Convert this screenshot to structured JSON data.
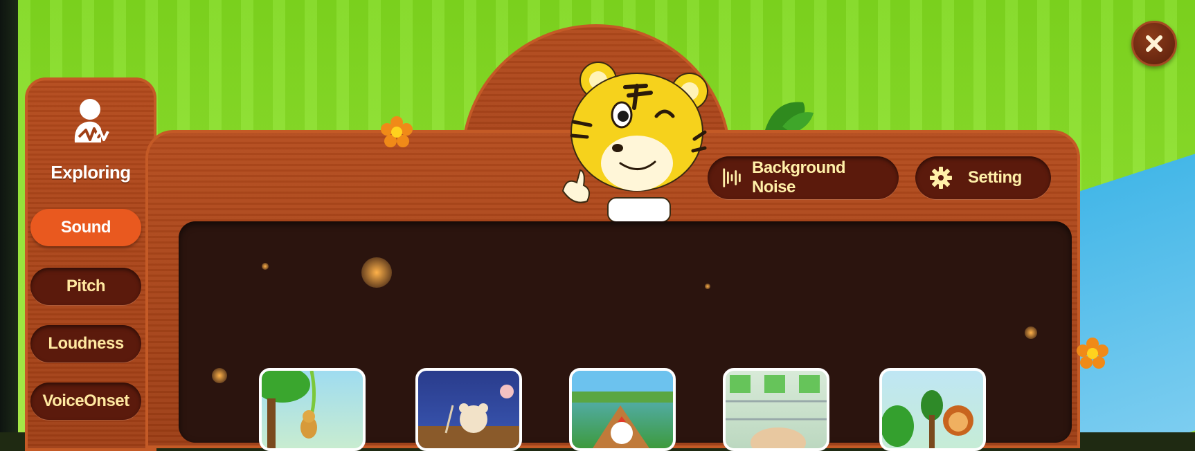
{
  "sidebar": {
    "heading": "Exploring",
    "heading_icon": "person-voice-wave-icon",
    "items": [
      {
        "label": "Sound",
        "active": true
      },
      {
        "label": "Pitch",
        "active": false
      },
      {
        "label": "Loudness",
        "active": false
      },
      {
        "label": "VoiceOnset",
        "active": false
      }
    ]
  },
  "header": {
    "background_noise_label": "Background Noise",
    "background_noise_icon": "sound-wave-icon",
    "setting_label": "Setting",
    "setting_icon": "gear-icon"
  },
  "close_icon": "close-icon",
  "cards": [
    {
      "name": "monkey-vine-card"
    },
    {
      "name": "bear-night-card"
    },
    {
      "name": "rooster-barn-card"
    },
    {
      "name": "hamster-cage-card"
    },
    {
      "name": "lion-forest-card"
    }
  ],
  "colors": {
    "accent_active": "#e9591f",
    "wood": "#b24a1b",
    "button_dark": "#5b1a0c",
    "panel": "#2b140e",
    "label_yellow": "#fff0a8"
  }
}
